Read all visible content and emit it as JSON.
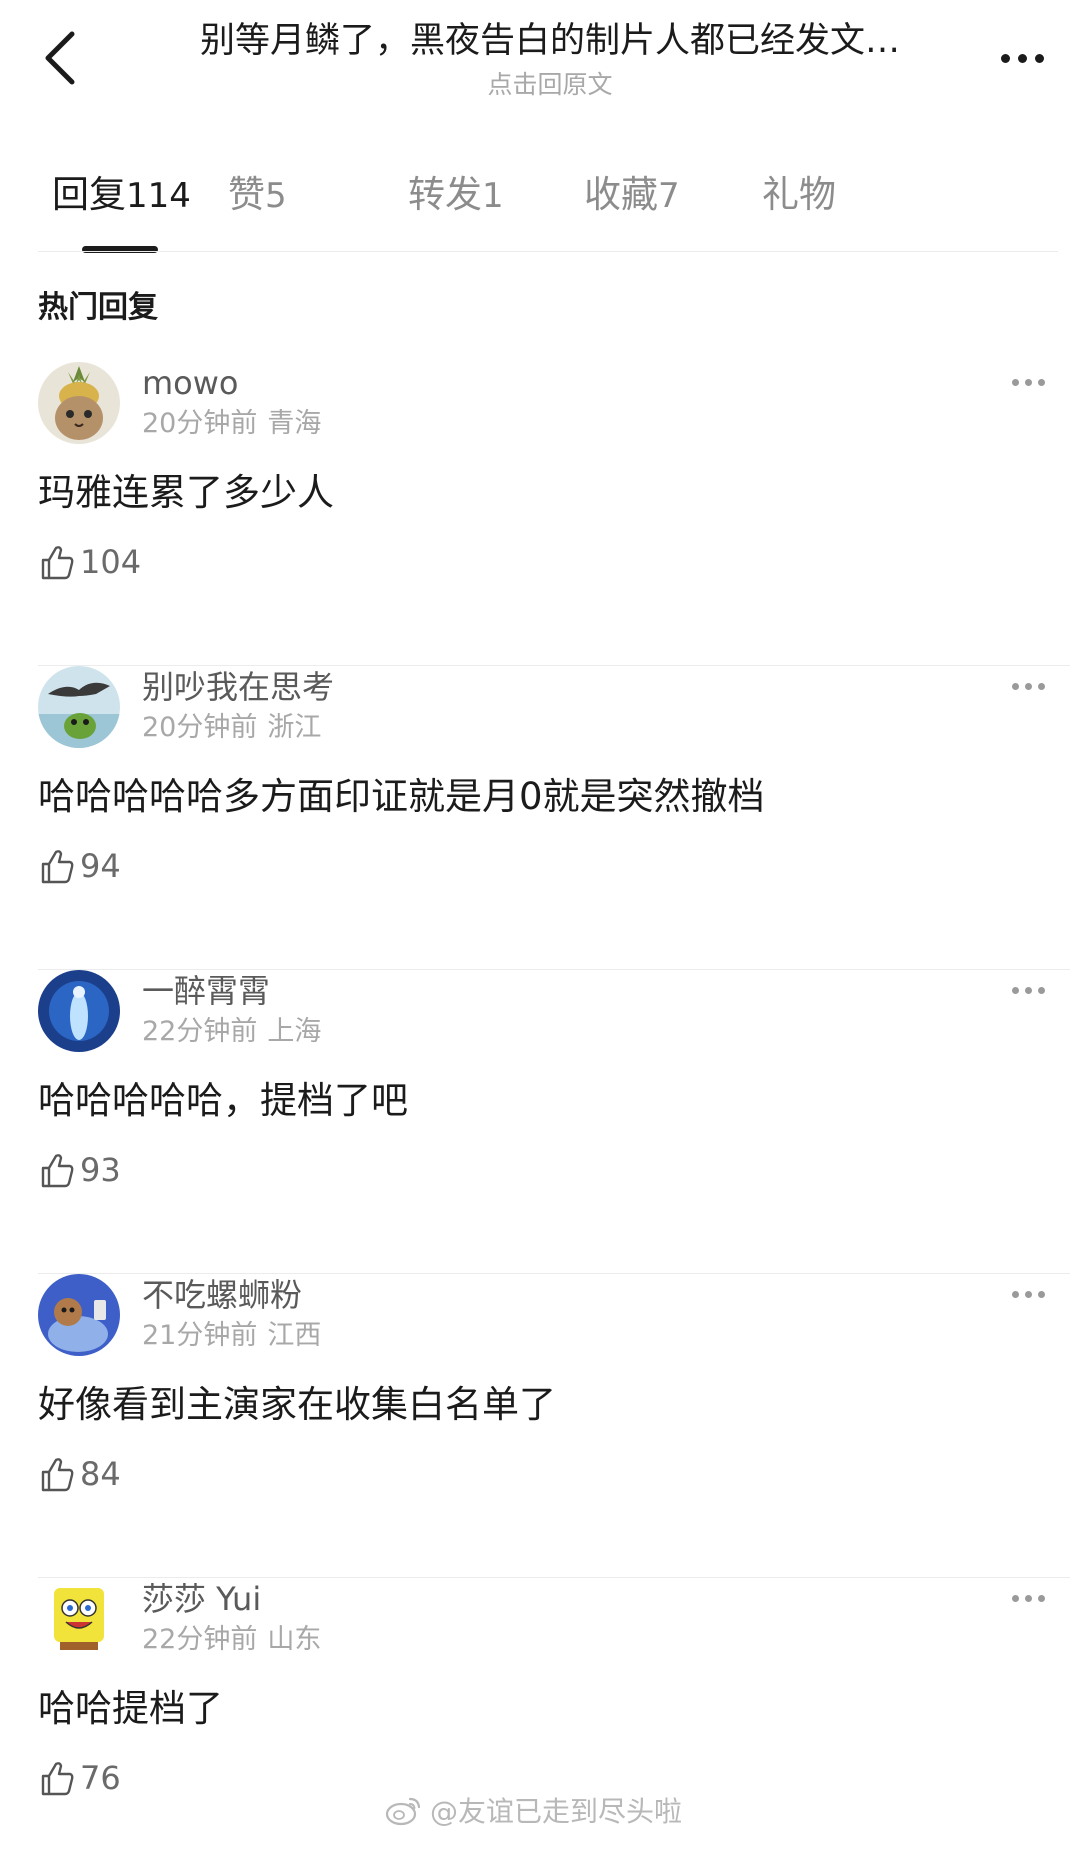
{
  "header": {
    "title": "别等月鳞了，黑夜告白的制片人都已经发文…",
    "subtitle": "点击回原文"
  },
  "tabs": [
    {
      "label": "回复",
      "count": "114",
      "active": true
    },
    {
      "label": "赞",
      "count": "5",
      "active": false
    },
    {
      "label": "转发",
      "count": "1",
      "active": false
    },
    {
      "label": "收藏",
      "count": "7",
      "active": false
    },
    {
      "label": "礼物",
      "count": "",
      "active": false
    }
  ],
  "section_title": "热门回复",
  "comments": [
    {
      "user": "mowo",
      "time": "20分钟前",
      "location": "青海",
      "text": "玛雅连累了多少人",
      "likes": "104",
      "avatar_icon": "pineapple-cat-avatar"
    },
    {
      "user": "别吵我在思考",
      "time": "20分钟前",
      "location": "浙江",
      "text": "哈哈哈哈哈多方面印证就是月0就是突然撤档",
      "likes": "94",
      "avatar_icon": "bird-frog-avatar"
    },
    {
      "user": "一醉霄霄",
      "time": "22分钟前",
      "location": "上海",
      "text": "哈哈哈哈哈，提档了吧",
      "likes": "93",
      "avatar_icon": "glowing-figure-avatar"
    },
    {
      "user": "不吃螺蛳粉",
      "time": "21分钟前",
      "location": "江西",
      "text": "好像看到主演家在收集白名单了",
      "likes": "84",
      "avatar_icon": "cartoon-character-avatar"
    },
    {
      "user": "莎莎 Yui",
      "time": "22分钟前",
      "location": "山东",
      "text": "哈哈提档了",
      "likes": "76",
      "avatar_icon": "spongebob-avatar"
    }
  ],
  "watermark": {
    "text": "@友谊已走到尽头啦",
    "icon": "weibo-logo-icon"
  },
  "colors": {
    "primary_text": "#1b1b1b",
    "secondary_text": "#a8a8a8",
    "username": "#5a5a5a",
    "divider": "#ececec"
  }
}
